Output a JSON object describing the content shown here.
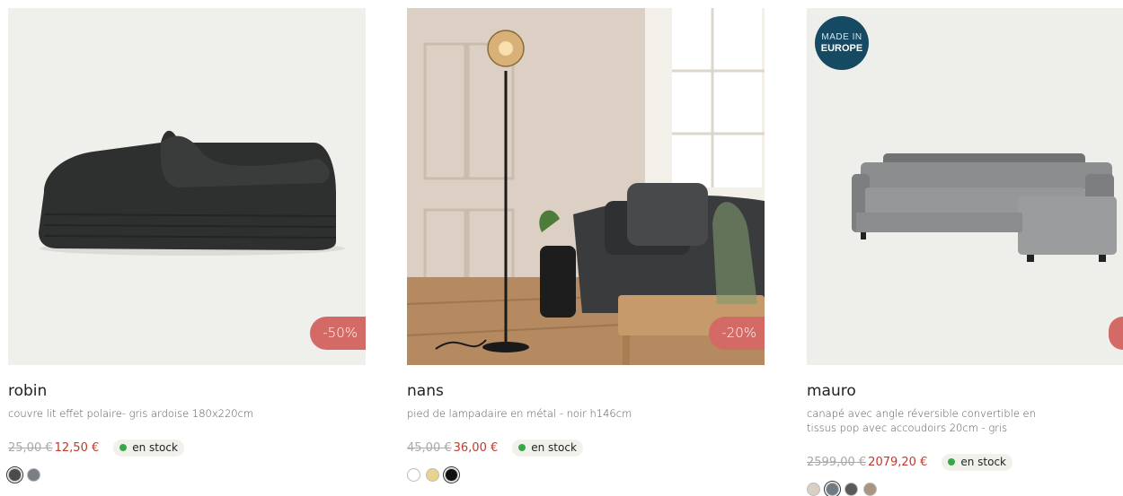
{
  "products": [
    {
      "name": "robin",
      "description": "couvre lit effet polaire- gris ardoise 180x220cm",
      "old_price": "25,00 €",
      "new_price": "12,50 €",
      "stock": "en stock",
      "discount": "-50%",
      "badge": "",
      "swatches": [
        "#4a4b4d",
        "#7a7f86"
      ]
    },
    {
      "name": "nans",
      "description": "pied de lampadaire en métal - noir h146cm",
      "old_price": "45,00 €",
      "new_price": "36,00 €",
      "stock": "en stock",
      "discount": "-20%",
      "badge": "",
      "swatches": [
        "#ffffff",
        "#e9d28a",
        "#111111"
      ]
    },
    {
      "name": "mauro",
      "description": "canapé avec angle réversible convertible en tissus pop avec accoudoirs 20cm - gris",
      "old_price": "2599,00 €",
      "new_price": "2079,20 €",
      "stock": "en stock",
      "discount": "",
      "badge": {
        "line1": "MADE IN",
        "line2": "EUROPE"
      },
      "swatches": [
        "#d9cfc2",
        "#6f7a82",
        "#5a5a5a",
        "#a99582"
      ]
    }
  ],
  "colors": {
    "discount": "#d46a66",
    "sale_price": "#c0392b",
    "in_stock": "#3aa64a",
    "badge": "#164a63"
  }
}
